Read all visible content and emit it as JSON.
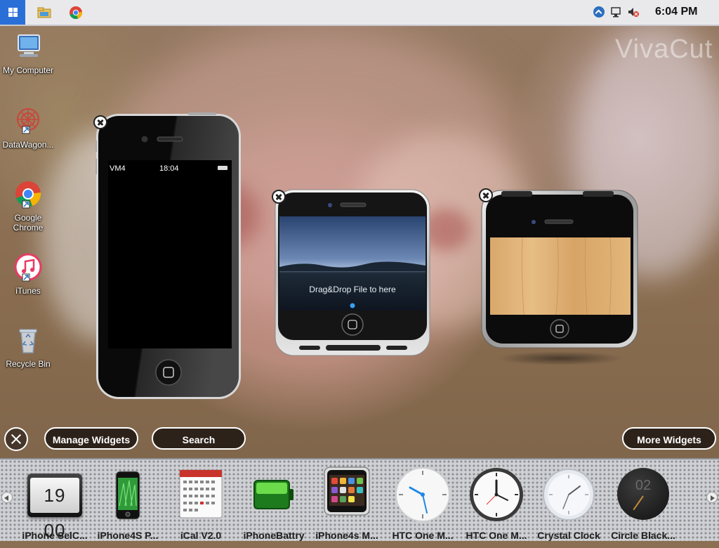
{
  "taskbar": {
    "start_icon": "windows-logo-icon",
    "pinned": [
      "file-explorer-icon",
      "chrome-icon"
    ],
    "tray_icons": [
      "show-hidden-icons-icon",
      "network-icon",
      "volume-muted-icon"
    ],
    "clock": "6:04 PM"
  },
  "wallpaper": {
    "watermark": "VivaCut"
  },
  "desktop_icons": [
    {
      "label": "My Computer",
      "icon": "computer-icon"
    },
    {
      "label": "DataWagon...",
      "icon": "datawagon-icon"
    },
    {
      "label": "Google Chrome",
      "icon": "chrome-icon"
    },
    {
      "label": "iTunes",
      "icon": "itunes-icon"
    },
    {
      "label": "Recycle Bin",
      "icon": "recycle-bin-icon"
    }
  ],
  "widgets": {
    "iphone4": {
      "carrier": "VM4",
      "time": "18:04"
    },
    "dropzone": {
      "text": "Drag&Drop File to here"
    }
  },
  "widget_bar": {
    "manage_label": "Manage Widgets",
    "search_label": "Search",
    "more_label": "More Widgets"
  },
  "gallery": {
    "items": [
      {
        "label": "iPhone SelC...",
        "icon": "flip-clock-icon",
        "display": "19 00"
      },
      {
        "label": "iPhone4S P...",
        "icon": "iphone-icon"
      },
      {
        "label": "iCal V2.0",
        "icon": "calendar-icon"
      },
      {
        "label": "iPhoneBattry",
        "icon": "battery-icon"
      },
      {
        "label": "iPhone4s M...",
        "icon": "iphone-apps-icon"
      },
      {
        "label": "HTC One M...",
        "icon": "white-clock-icon"
      },
      {
        "label": "HTC One M...",
        "icon": "dark-rim-clock-icon"
      },
      {
        "label": "Crystal Clock",
        "icon": "crystal-clock-icon"
      },
      {
        "label": "Circle Black...",
        "icon": "black-circle-clock-icon",
        "display": "02"
      }
    ]
  }
}
